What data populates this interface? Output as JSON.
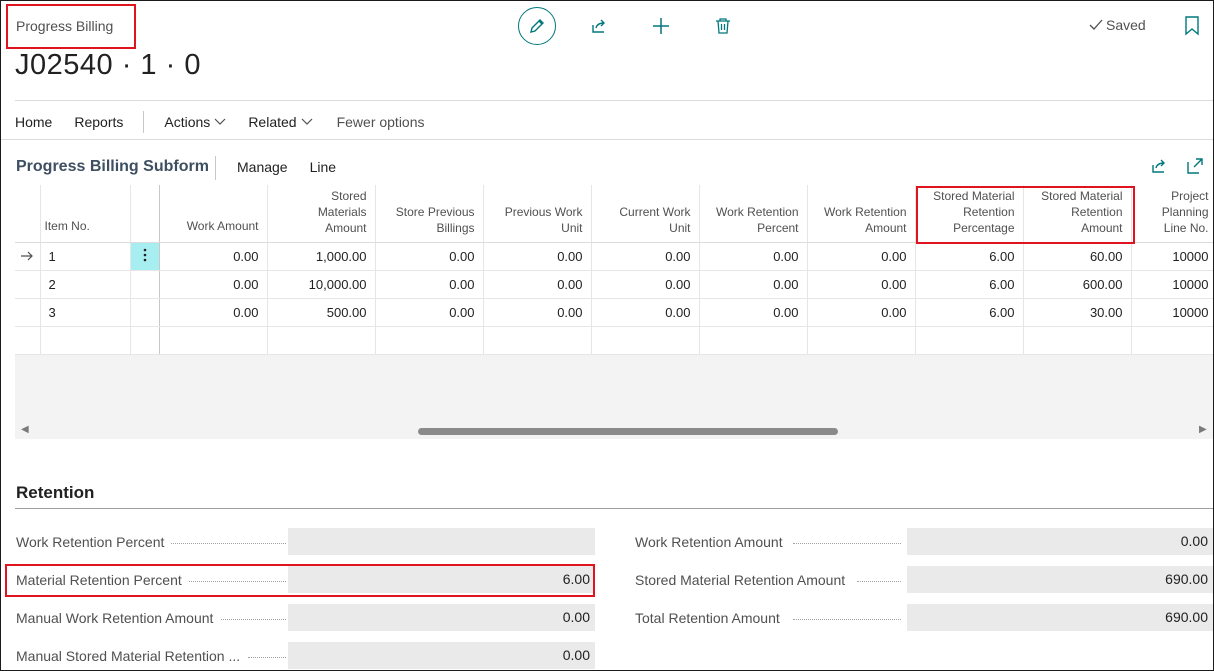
{
  "header": {
    "caption": "Progress Billing",
    "title": "J02540 · 1 · 0",
    "saved_label": "Saved"
  },
  "toolbar": {
    "icons": [
      "edit-icon",
      "share-icon",
      "add-icon",
      "delete-icon",
      "bookmark-icon"
    ]
  },
  "actionbar": {
    "home": "Home",
    "reports": "Reports",
    "actions": "Actions",
    "related": "Related",
    "fewer": "Fewer options"
  },
  "subform": {
    "title": "Progress Billing Subform",
    "manage": "Manage",
    "line": "Line",
    "columns": {
      "item_no": "Item No.",
      "work_amount": "Work Amount",
      "stored_materials_amount": [
        "Stored",
        "Materials",
        "Amount"
      ],
      "store_previous_billings": [
        "Store Previous",
        "Billings"
      ],
      "previous_work_unit": [
        "Previous Work",
        "Unit"
      ],
      "current_work_unit": [
        "Current Work",
        "Unit"
      ],
      "work_retention_percent": [
        "Work Retention",
        "Percent"
      ],
      "work_retention_amount": [
        "Work Retention",
        "Amount"
      ],
      "stored_material_retention_percentage": [
        "Stored Material",
        "Retention",
        "Percentage"
      ],
      "stored_material_retention_amount": [
        "Stored Material",
        "Retention",
        "Amount"
      ],
      "project_planning_line_no": [
        "Project",
        "Planning",
        "Line No."
      ]
    },
    "rows": [
      {
        "item_no": "1",
        "work_amount": "0.00",
        "stored_materials_amount": "1,000.00",
        "store_previous_billings": "0.00",
        "previous_work_unit": "0.00",
        "current_work_unit": "0.00",
        "work_retention_percent": "0.00",
        "work_retention_amount": "0.00",
        "stored_material_retention_percentage": "6.00",
        "stored_material_retention_amount": "60.00",
        "project_planning_line_no": "10000"
      },
      {
        "item_no": "2",
        "work_amount": "0.00",
        "stored_materials_amount": "10,000.00",
        "store_previous_billings": "0.00",
        "previous_work_unit": "0.00",
        "current_work_unit": "0.00",
        "work_retention_percent": "0.00",
        "work_retention_amount": "0.00",
        "stored_material_retention_percentage": "6.00",
        "stored_material_retention_amount": "600.00",
        "project_planning_line_no": "10000"
      },
      {
        "item_no": "3",
        "work_amount": "0.00",
        "stored_materials_amount": "500.00",
        "store_previous_billings": "0.00",
        "previous_work_unit": "0.00",
        "current_work_unit": "0.00",
        "work_retention_percent": "0.00",
        "work_retention_amount": "0.00",
        "stored_material_retention_percentage": "6.00",
        "stored_material_retention_amount": "30.00",
        "project_planning_line_no": "10000"
      }
    ]
  },
  "retention": {
    "title": "Retention",
    "left": [
      {
        "label": "Work Retention Percent",
        "value": ""
      },
      {
        "label": "Material Retention Percent",
        "value": "6.00"
      },
      {
        "label": "Manual Work Retention Amount",
        "value": "0.00"
      },
      {
        "label": "Manual Stored Material Retention ...",
        "value": "0.00"
      }
    ],
    "right": [
      {
        "label": "Work Retention Amount",
        "value": "0.00"
      },
      {
        "label": "Stored Material Retention Amount",
        "value": "690.00"
      },
      {
        "label": "Total Retention Amount",
        "value": "690.00"
      }
    ]
  },
  "colors": {
    "accent": "#00787d",
    "highlight": "#e0141e",
    "active_cell": "#a7eef1"
  }
}
